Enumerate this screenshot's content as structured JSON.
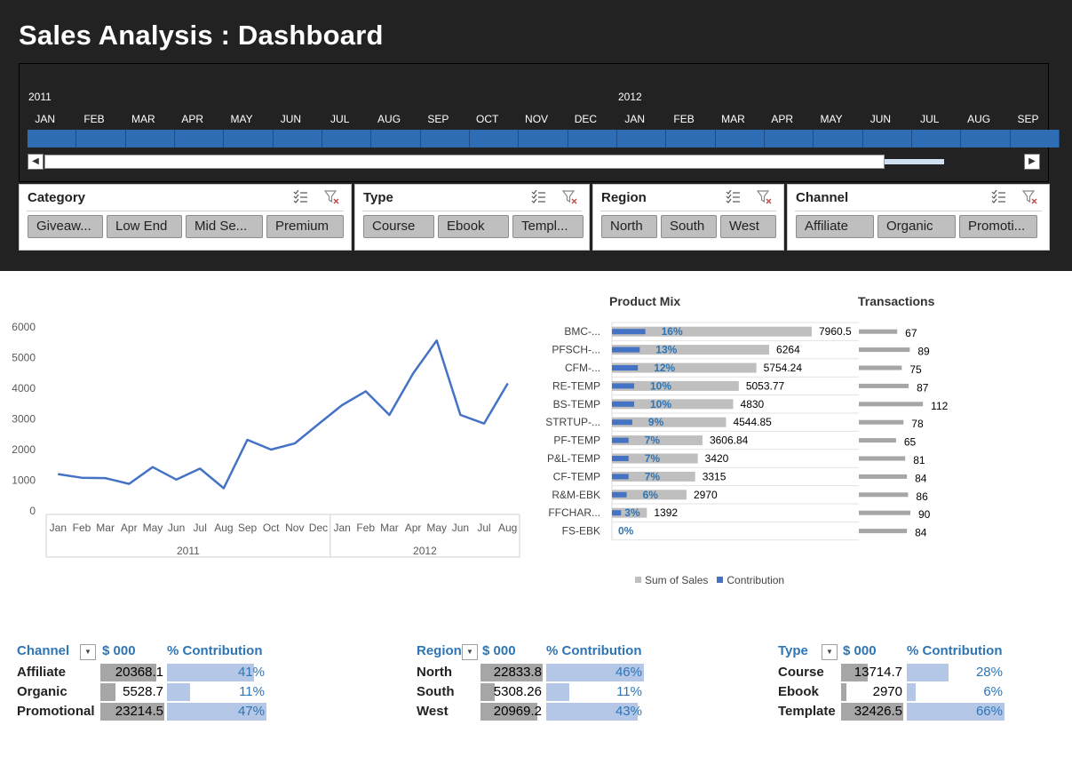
{
  "title": "Sales Analysis : Dashboard",
  "timeline": {
    "years": [
      "2011",
      "2012"
    ],
    "months": [
      "JAN",
      "FEB",
      "MAR",
      "APR",
      "MAY",
      "JUN",
      "JUL",
      "AUG",
      "SEP",
      "OCT",
      "NOV",
      "DEC",
      "JAN",
      "FEB",
      "MAR",
      "APR",
      "MAY",
      "JUN",
      "JUL",
      "AUG",
      "SEP"
    ],
    "scroll_left": "◀",
    "scroll_right": "▶"
  },
  "slicers": {
    "category": {
      "title": "Category",
      "items": [
        "Giveaw...",
        "Low End",
        "Mid Se...",
        "Premium"
      ]
    },
    "type": {
      "title": "Type",
      "items": [
        "Course",
        "Ebook",
        "Templ..."
      ]
    },
    "region": {
      "title": "Region",
      "items": [
        "North",
        "South",
        "West"
      ]
    },
    "channel": {
      "title": "Channel",
      "items": [
        "Affiliate",
        "Organic",
        "Promoti..."
      ]
    }
  },
  "chart_data": [
    {
      "type": "line",
      "x": [
        "Jan",
        "Feb",
        "Mar",
        "Apr",
        "May",
        "Jun",
        "Jul",
        "Aug",
        "Sep",
        "Oct",
        "Nov",
        "Dec",
        "Jan",
        "Feb",
        "Mar",
        "Apr",
        "May",
        "Jun",
        "Jul",
        "Aug"
      ],
      "x_groups": [
        {
          "label": "2011",
          "count": 12
        },
        {
          "label": "2012",
          "count": 8
        }
      ],
      "values": [
        1200,
        1080,
        1070,
        880,
        1430,
        1020,
        1380,
        740,
        2320,
        2000,
        2200,
        2830,
        3450,
        3900,
        3130,
        4480,
        5560,
        3130,
        2850,
        4160
      ],
      "ylim": [
        0,
        6000
      ],
      "yticks": [
        0,
        1000,
        2000,
        3000,
        4000,
        5000,
        6000
      ],
      "color": "#4472c4"
    },
    {
      "type": "bar",
      "title": "Product Mix",
      "categories": [
        "BMC-...",
        "PFSCH-...",
        "CFM-...",
        "RE-TEMP",
        "BS-TEMP",
        "STRTUP-...",
        "PF-TEMP",
        "P&L-TEMP",
        "CF-TEMP",
        "R&M-EBK",
        "FFCHAR...",
        "FS-EBK"
      ],
      "series": [
        {
          "name": "Sum of Sales",
          "values": [
            7960.5,
            6264,
            5754.24,
            5053.77,
            4830,
            4544.85,
            3606.84,
            3420,
            3315,
            2970,
            1392,
            0
          ],
          "color": "#bfbfbf"
        },
        {
          "name": "Contribution",
          "values": [
            16,
            13,
            12,
            10,
            10,
            9,
            7,
            7,
            7,
            6,
            3,
            0
          ],
          "labels": [
            "16%",
            "13%",
            "12%",
            "10%",
            "10%",
            "9%",
            "7%",
            "7%",
            "7%",
            "6%",
            "3%",
            "0%"
          ],
          "color": "#4472c4"
        }
      ],
      "value_labels": [
        "7960.5",
        "6264",
        "5754.24",
        "5053.77",
        "4830",
        "4544.85",
        "3606.84",
        "3420",
        "3315",
        "2970",
        "1392",
        ""
      ]
    },
    {
      "type": "bar",
      "title": "Transactions",
      "values": [
        67,
        89,
        75,
        87,
        112,
        78,
        65,
        81,
        84,
        86,
        90,
        84
      ],
      "color": "#a6a6a6"
    }
  ],
  "legend": {
    "sales": "Sum of Sales",
    "contribution": "Contribution"
  },
  "tables": {
    "channel": {
      "header": "Channel",
      "col_value": "$ 000",
      "col_pct": "% Contribution",
      "rows": [
        {
          "label": "Affiliate",
          "value": "20368.1",
          "pct": "41%",
          "v": 20368.1,
          "p": 41
        },
        {
          "label": "Organic",
          "value": "5528.7",
          "pct": "11%",
          "v": 5528.7,
          "p": 11
        },
        {
          "label": "Promotional",
          "value": "23214.5",
          "pct": "47%",
          "v": 23214.5,
          "p": 47
        }
      ]
    },
    "region": {
      "header": "Region",
      "col_value": "$ 000",
      "col_pct": "% Contribution",
      "rows": [
        {
          "label": "North",
          "value": "22833.8",
          "pct": "46%",
          "v": 22833.8,
          "p": 46
        },
        {
          "label": "South",
          "value": "5308.26",
          "pct": "11%",
          "v": 5308.26,
          "p": 11
        },
        {
          "label": "West",
          "value": "20969.2",
          "pct": "43%",
          "v": 20969.2,
          "p": 43
        }
      ]
    },
    "type": {
      "header": "Type",
      "col_value": "$ 000",
      "col_pct": "% Contribution",
      "rows": [
        {
          "label": "Course",
          "value": "13714.7",
          "pct": "28%",
          "v": 13714.7,
          "p": 28
        },
        {
          "label": "Ebook",
          "value": "2970",
          "pct": "6%",
          "v": 2970,
          "p": 6
        },
        {
          "label": "Template",
          "value": "32426.5",
          "pct": "66%",
          "v": 32426.5,
          "p": 66
        }
      ]
    }
  }
}
